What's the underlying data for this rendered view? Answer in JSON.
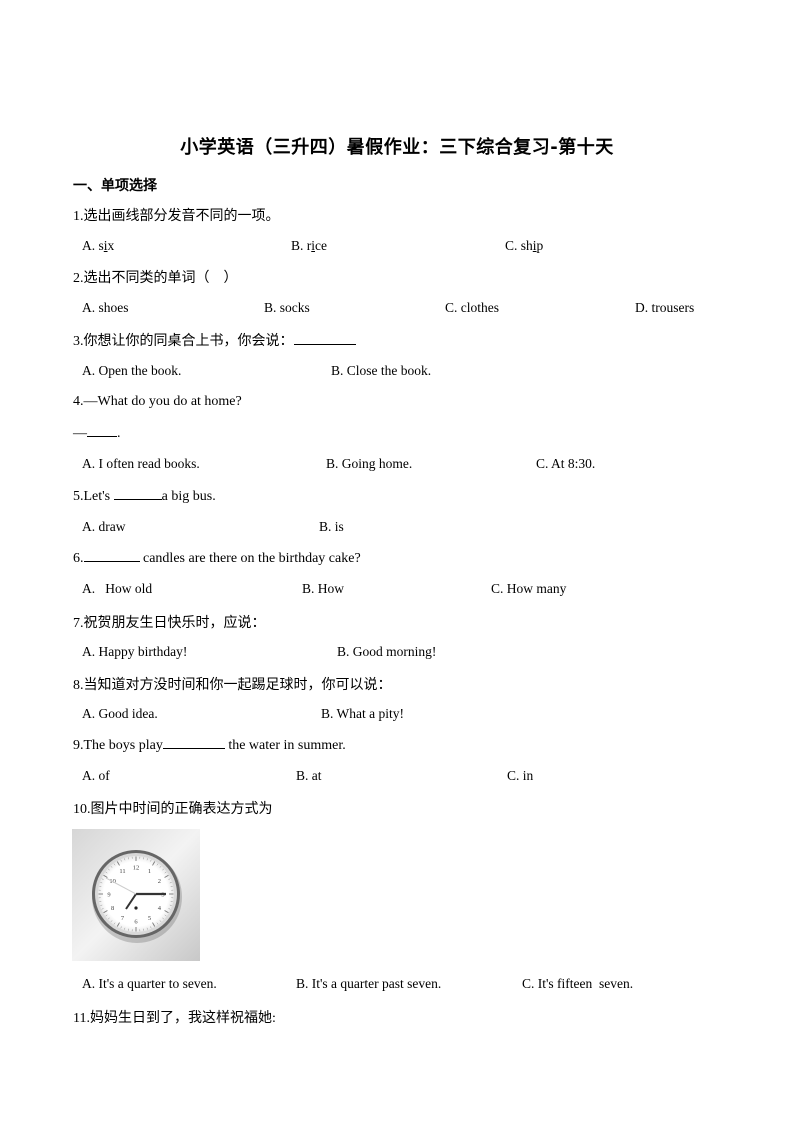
{
  "title": "小学英语（三升四）暑假作业：三下综合复习-第十天",
  "section": "一、单项选择",
  "questions": [
    {
      "stem": "1.选出画线部分发音不同的一项。",
      "options": [
        {
          "pre": "A. s",
          "ul": "i",
          "post": "x"
        },
        {
          "pre": "B. r",
          "ul": "i",
          "post": "ce"
        },
        {
          "pre": "C. sh",
          "ul": "i",
          "post": "p"
        }
      ]
    },
    {
      "stem": "2.选出不同类的单词（　）",
      "options": [
        "A. shoes",
        "B. socks",
        "C. clothes",
        "D. trousers"
      ]
    },
    {
      "stem": "3.你想让你的同桌合上书，你会说：",
      "options": [
        "A. Open the book.",
        "B. Close the book."
      ]
    },
    {
      "stem": "4.—What do you do at home?",
      "answer_prefix": "—",
      "answer_suffix": ".",
      "options": [
        "A. I often read books.",
        "B. Going home.",
        "C. At 8:30."
      ]
    },
    {
      "stem_pre": "5.Let's ",
      "stem_post": "a big bus.",
      "options": [
        "A. draw",
        "B. is"
      ]
    },
    {
      "stem_pre": "6.",
      "stem_post": " candles are there on the birthday cake?",
      "options": [
        "A.   How old",
        "B. How",
        "C. How many"
      ]
    },
    {
      "stem": "7.祝贺朋友生日快乐时，应说：",
      "options": [
        "A. Happy birthday!",
        "B. Good morning!"
      ]
    },
    {
      "stem": "8.当知道对方没时间和你一起踢足球时，你可以说：",
      "options": [
        "A. Good idea.",
        "B. What a pity!"
      ]
    },
    {
      "stem_pre": "9.The boys play",
      "stem_post": " the water in summer.",
      "options": [
        "A. of",
        "B. at",
        "C. in"
      ]
    },
    {
      "stem": "10.图片中时间的正确表达方式为",
      "image": "clock-image",
      "clock_numbers": [
        "12",
        "1",
        "2",
        "3",
        "4",
        "5",
        "6",
        "7",
        "8",
        "9",
        "10",
        "11"
      ],
      "options": [
        "A. It's a quarter to seven.",
        "B. It's a quarter past seven.",
        "C. It's fifteen  seven."
      ]
    },
    {
      "stem": "11.妈妈生日到了，我这样祝福她:"
    }
  ]
}
